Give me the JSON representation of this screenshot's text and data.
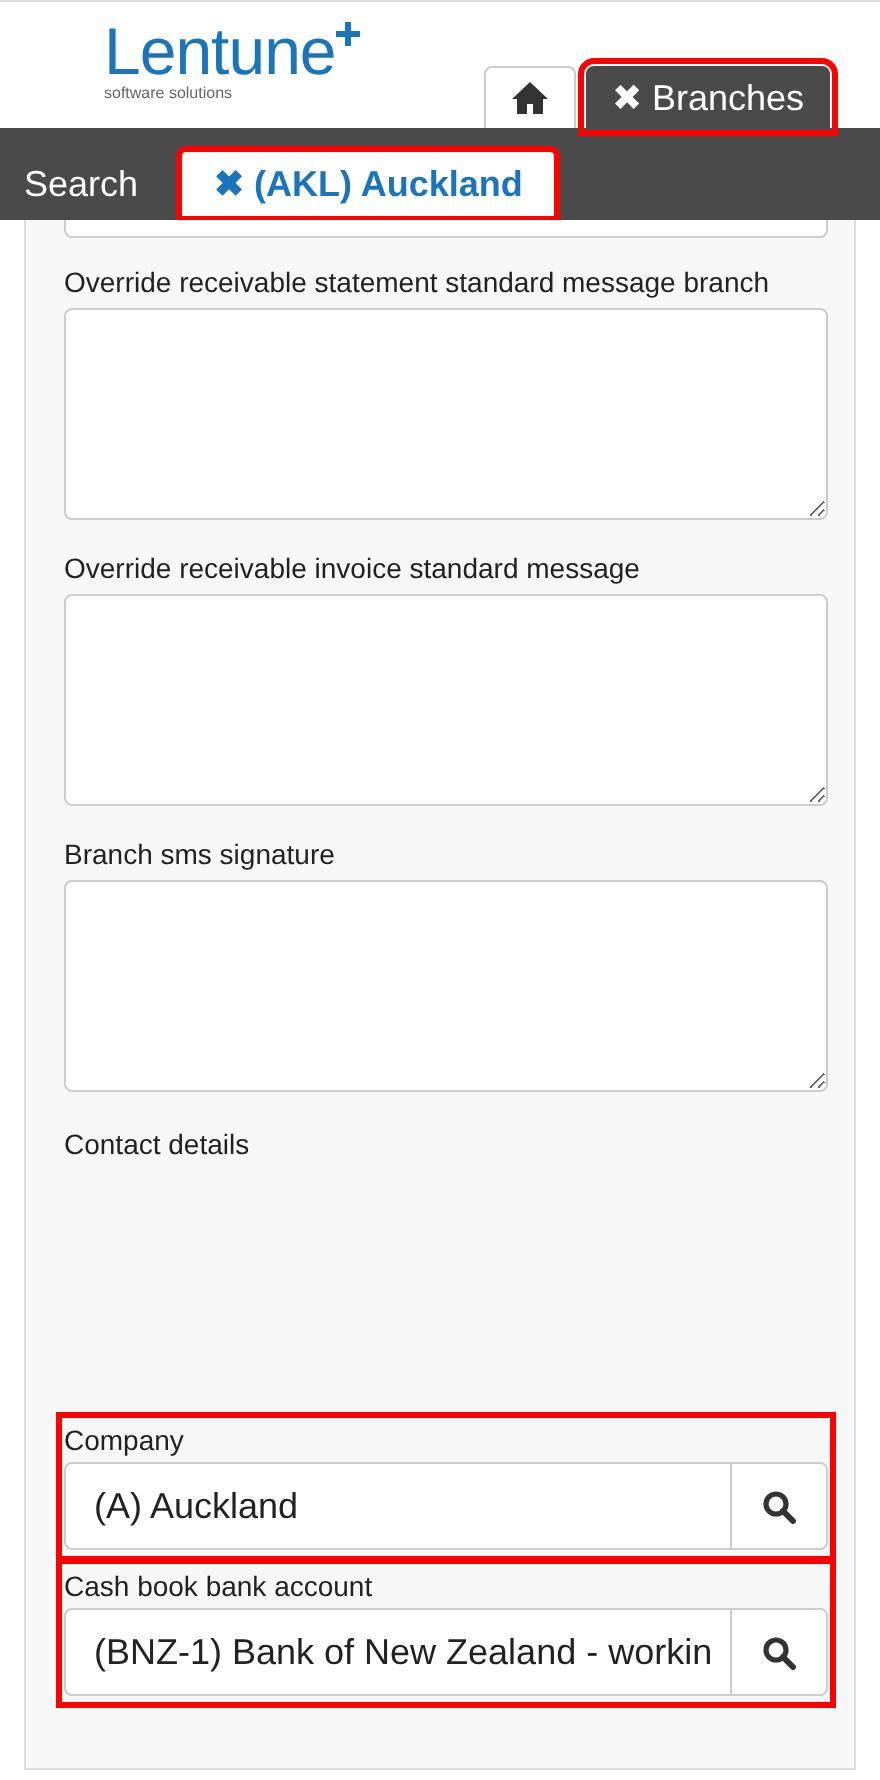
{
  "logo": {
    "name": "Lentune",
    "tagline": "software solutions"
  },
  "top_tabs": [
    {
      "kind": "home",
      "selected": false,
      "highlighted": false
    },
    {
      "kind": "text",
      "label": "Branches",
      "close": "✖",
      "selected": true,
      "highlighted": true
    }
  ],
  "sub_tabs": [
    {
      "label": "Search",
      "selected": false,
      "highlighted": false
    },
    {
      "label": "(AKL) Auckland",
      "close": "✖",
      "selected": true,
      "highlighted": true
    }
  ],
  "textareas": [
    {
      "label": "Override receivable statement standard message branch"
    },
    {
      "label": "Override receivable invoice standard message"
    },
    {
      "label": "Branch sms signature"
    }
  ],
  "section": "Contact details",
  "lookups": [
    {
      "label": "Company",
      "value": "(A) Auckland",
      "highlighted": true
    },
    {
      "label": "Cash book bank account",
      "value": "(BNZ-1) Bank of New Zealand - workin",
      "highlighted": true
    }
  ]
}
